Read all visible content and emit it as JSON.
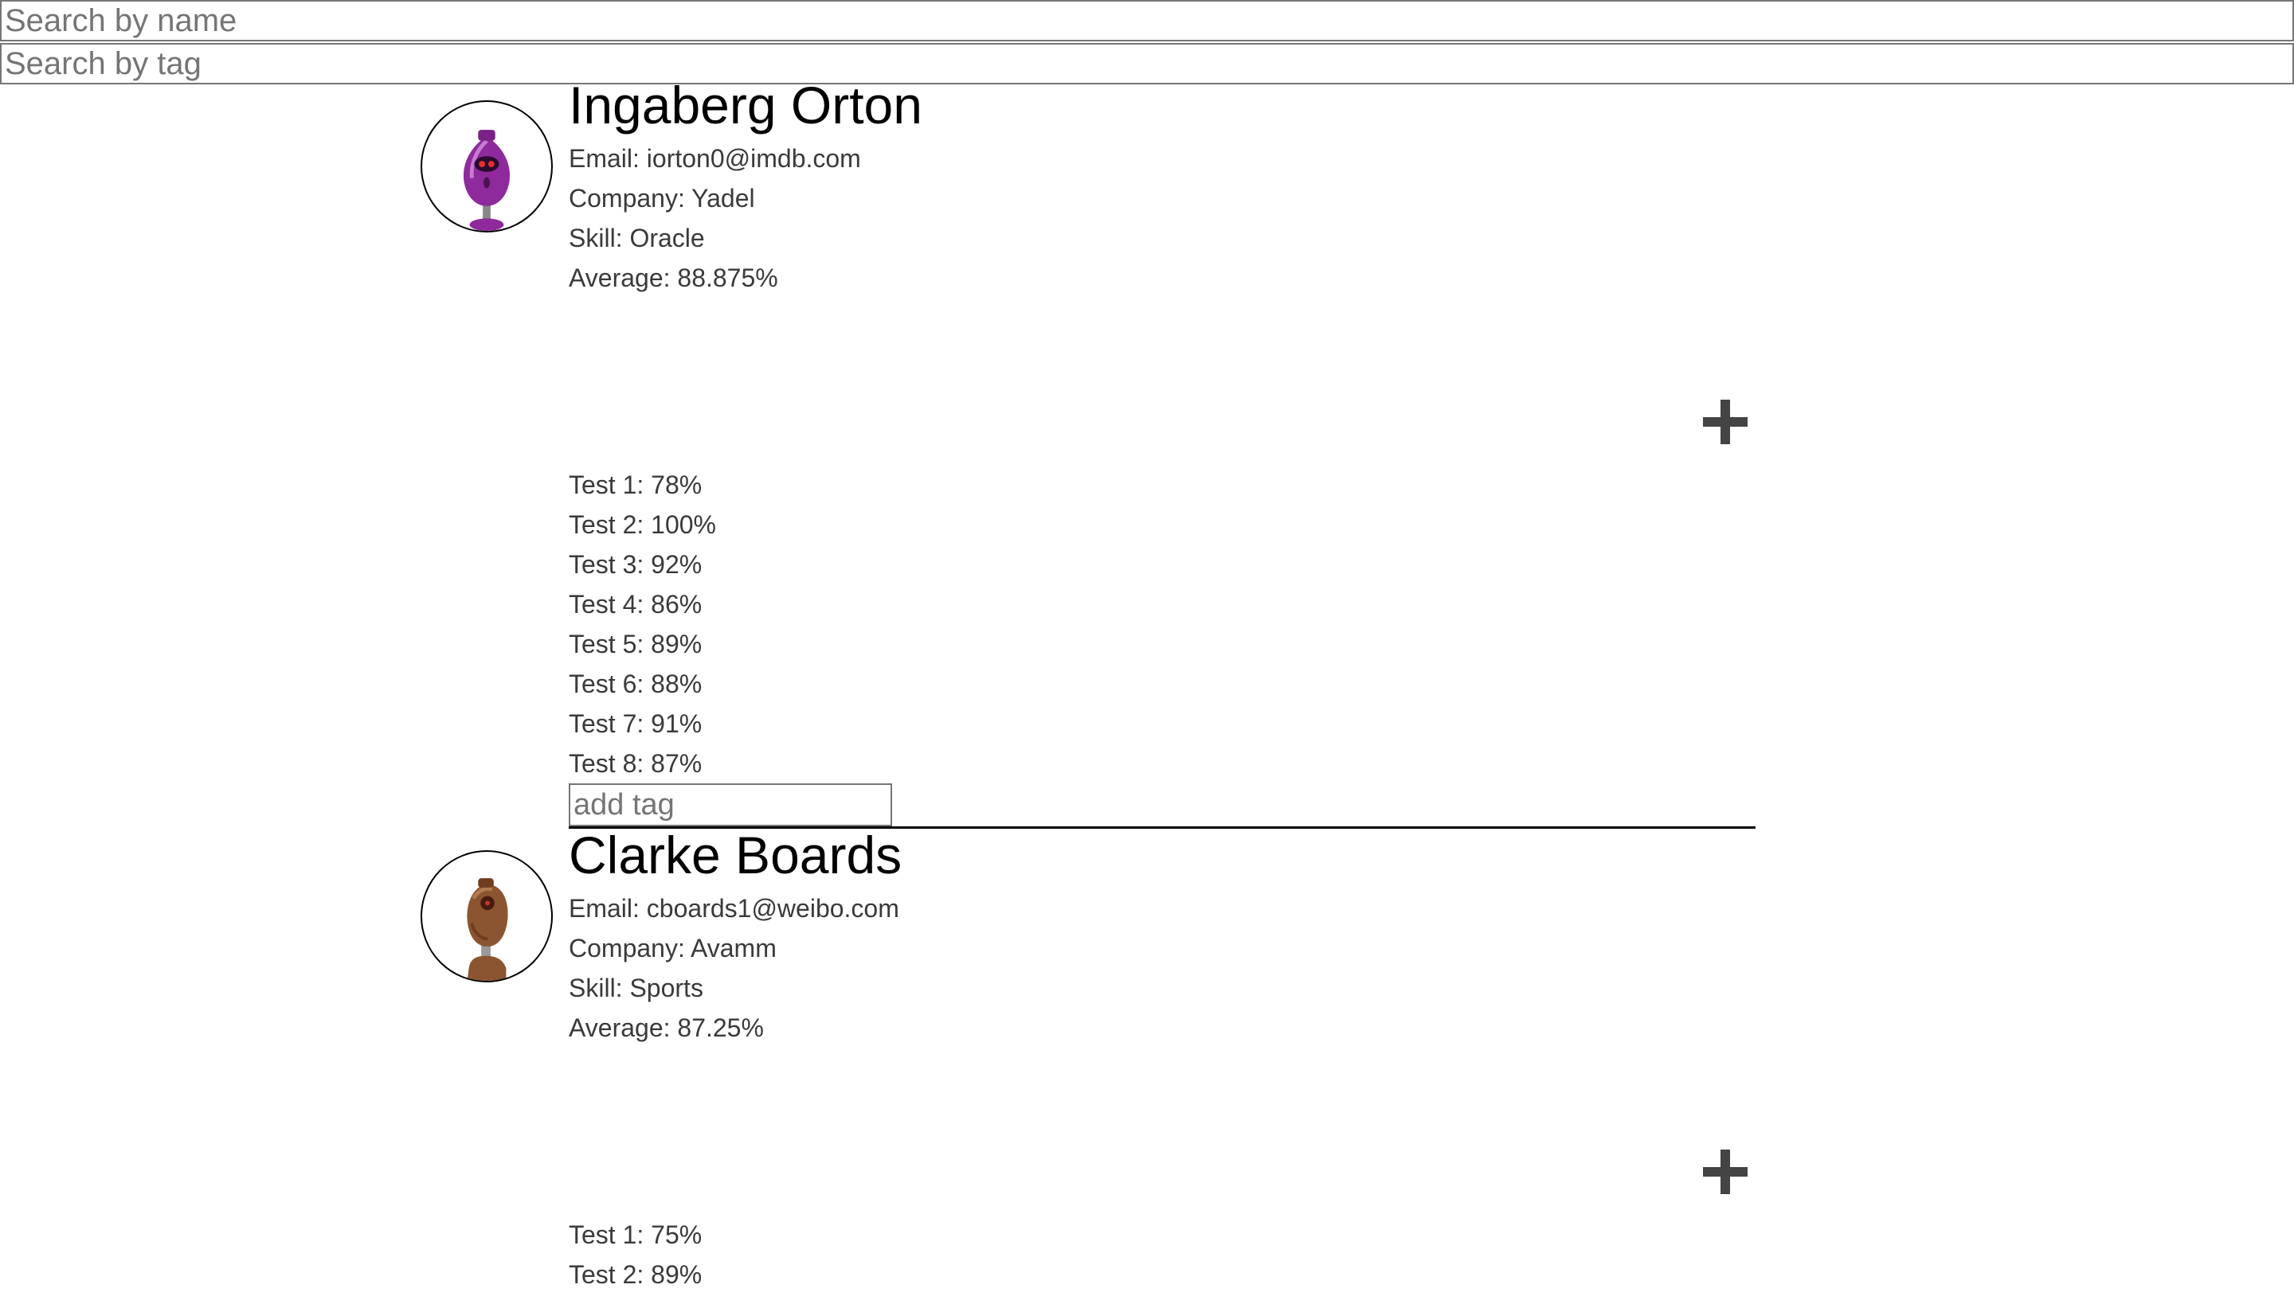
{
  "search": {
    "name_placeholder": "Search by name",
    "tag_placeholder": "Search by tag"
  },
  "students": [
    {
      "name": "Ingaberg Orton",
      "email": "Email: iorton0@imdb.com",
      "company": "Company: Yadel",
      "skill": "Skill: Oracle",
      "average": "Average: 88.875%",
      "avatar_color": "#8e2a9c",
      "tests": [
        "Test 1: 78%",
        "Test 2: 100%",
        "Test 3: 92%",
        "Test 4: 86%",
        "Test 5: 89%",
        "Test 6: 88%",
        "Test 7: 91%",
        "Test 8: 87%"
      ],
      "tag_placeholder": "add tag"
    },
    {
      "name": "Clarke Boards",
      "email": "Email: cboards1@weibo.com",
      "company": "Company: Avamm",
      "skill": "Skill: Sports",
      "average": "Average: 87.25%",
      "avatar_color": "#8a5530",
      "tests": [
        "Test 1: 75%",
        "Test 2: 89%"
      ]
    }
  ],
  "icons": {
    "expand": "plus-icon",
    "avatar": "robot-avatar-icon"
  }
}
